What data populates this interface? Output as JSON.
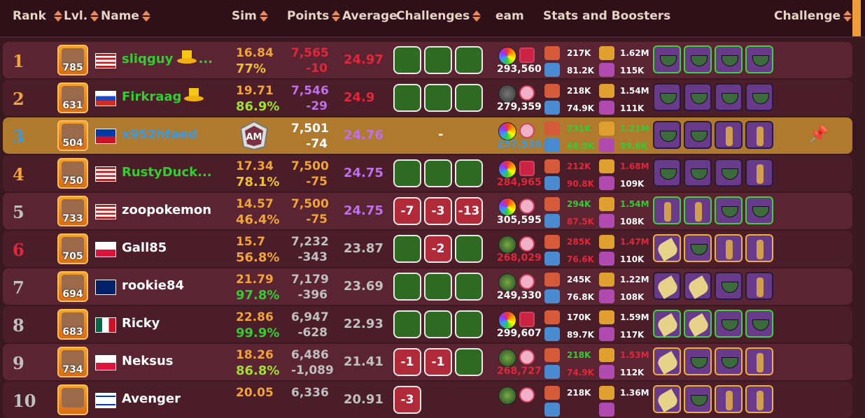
{
  "headers": {
    "rank": "Rank",
    "lvl": "Lvl.",
    "name": "Name",
    "sim": "Sim",
    "points": "Points",
    "average": "Average",
    "challenges": "Challenges",
    "team": "eam",
    "stats": "Stats and Boosters",
    "challenge": "Challenge"
  },
  "colors": {
    "row_dark": "#5a2433",
    "row_light": "#4a1d29",
    "row_me": "#b07a2e",
    "green_name": "#33cc33",
    "orange": "#f0a43a",
    "red_text": "#e0283a",
    "purple_text": "#c070e8"
  },
  "rows": [
    {
      "rank": "1",
      "rank_color": "#f0a43a",
      "level": "785",
      "flag": "us",
      "name": "sliqguy",
      "name_color": "#33cc33",
      "name_suffix": "...",
      "crown": "gold-top-hat",
      "sim_value": "16.84",
      "sim_pct": "77%",
      "sim_pct_color": "#f0c030",
      "points": "7,565",
      "points_color": "#e0283a",
      "diff": "-10",
      "diff_color": "#e0283a",
      "average": "24.97",
      "average_color": "#e0283a",
      "challenges": [
        {
          "type": "g",
          "text": ""
        },
        {
          "type": "g",
          "text": ""
        },
        {
          "type": "g",
          "text": ""
        }
      ],
      "team_orb": "rainbow",
      "team_badge": "kiss",
      "power": "293,560",
      "power_color": "#ffffff",
      "stats": {
        "atk": "217K",
        "hp": "81.2K",
        "ego": "1.62M",
        "harm": "115K"
      },
      "stats_colors": {
        "atk": "#ffffff",
        "hp": "#ffffff",
        "ego": "#ffffff",
        "harm": "#ffffff"
      },
      "boosters": [
        "bowl-g",
        "bowl-g",
        "bowl-g",
        "bowl-g"
      ]
    },
    {
      "rank": "2",
      "rank_color": "#f0a43a",
      "level": "631",
      "flag": "ru",
      "name": "Firkraag",
      "name_color": "#33cc33",
      "name_suffix": "",
      "crown": "gold-top-hat",
      "sim_value": "19.71",
      "sim_pct": "86.9%",
      "sim_pct_color": "#a0e030",
      "points": "7,546",
      "points_color": "#c070e8",
      "diff": "-29",
      "diff_color": "#c070e8",
      "average": "24.9",
      "average_color": "#e0283a",
      "challenges": [
        {
          "type": "g",
          "text": ""
        },
        {
          "type": "g",
          "text": ""
        },
        {
          "type": "g",
          "text": ""
        }
      ],
      "team_orb": "dark",
      "team_badge": "heart",
      "power": "279,359",
      "power_color": "#ffffff",
      "stats": {
        "atk": "218K",
        "hp": "74.9K",
        "ego": "1.54M",
        "harm": "111K"
      },
      "stats_colors": {
        "atk": "#ffffff",
        "hp": "#ffffff",
        "ego": "#ffffff",
        "harm": "#ffffff"
      },
      "boosters": [
        "bowl",
        "bowl",
        "bowl",
        "bowl"
      ]
    },
    {
      "rank": "3",
      "rank_color": "#3a9ae0",
      "level": "504",
      "flag": "ph",
      "name": "x952htaed",
      "name_color": "#3a9ae0",
      "name_suffix": "",
      "crown": "",
      "sim_value": "",
      "sim_pct": "",
      "sim_pct_color": "#ffffff",
      "points": "7,501",
      "points_color": "#ffffff",
      "diff": "-74",
      "diff_color": "#ffffff",
      "average": "24.76",
      "average_color": "#c070e8",
      "challenges": [],
      "dash": "-",
      "team_orb": "rainbow",
      "team_badge": "heart",
      "power": "257,536",
      "power_color": "#3a9ae0",
      "stats": {
        "atk": "231K",
        "hp": "68.5K",
        "ego": "1.21M",
        "harm": "99.6K"
      },
      "stats_colors": {
        "atk": "#33cc33",
        "hp": "#33cc33",
        "ego": "#33cc33",
        "harm": "#33cc33"
      },
      "boosters": [
        "bowl",
        "bowl",
        "gin",
        "gin"
      ]
    },
    {
      "rank": "4",
      "rank_color": "#f0a43a",
      "level": "750",
      "flag": "us",
      "name": "RustyDuck...",
      "name_color": "#33cc33",
      "name_suffix": "",
      "crown": "",
      "sim_value": "17.34",
      "sim_pct": "78.1%",
      "sim_pct_color": "#f0c030",
      "points": "7,500",
      "points_color": "#f0a43a",
      "diff": "-75",
      "diff_color": "#f0a43a",
      "average": "24.75",
      "average_color": "#c070e8",
      "challenges": [
        {
          "type": "g",
          "text": ""
        },
        {
          "type": "g",
          "text": ""
        },
        {
          "type": "g",
          "text": ""
        }
      ],
      "team_orb": "rainbow",
      "team_badge": "kiss",
      "power": "284,965",
      "power_color": "#e0283a",
      "stats": {
        "atk": "212K",
        "hp": "90.8K",
        "ego": "1.68M",
        "harm": "109K"
      },
      "stats_colors": {
        "atk": "#e0283a",
        "hp": "#e0283a",
        "ego": "#e0283a",
        "harm": "#ffffff"
      },
      "boosters": [
        "bowl",
        "bowl",
        "bowl",
        "gin"
      ]
    },
    {
      "rank": "5",
      "rank_color": "#c0c0c0",
      "level": "733",
      "flag": "us",
      "name": "zoopokemon",
      "name_color": "#ffffff",
      "name_suffix": "",
      "crown": "",
      "sim_value": "14.57",
      "sim_pct": "46.4%",
      "sim_pct_color": "#f0a43a",
      "points": "7,500",
      "points_color": "#f0a43a",
      "diff": "-75",
      "diff_color": "#f0a43a",
      "average": "24.75",
      "average_color": "#c070e8",
      "challenges": [
        {
          "type": "r",
          "text": "-7"
        },
        {
          "type": "r",
          "text": "-3"
        },
        {
          "type": "r",
          "text": "-13"
        }
      ],
      "team_orb": "rainbow",
      "team_badge": "heart",
      "power": "305,595",
      "power_color": "#ffffff",
      "stats": {
        "atk": "294K",
        "hp": "87.5K",
        "ego": "1.54M",
        "harm": "108K"
      },
      "stats_colors": {
        "atk": "#33cc33",
        "hp": "#e0283a",
        "ego": "#33cc33",
        "harm": "#ffffff"
      },
      "boosters": [
        "gin-g",
        "gin-g",
        "bowl-g",
        "bowl-g"
      ]
    },
    {
      "rank": "6",
      "rank_color": "#e0283a",
      "level": "705",
      "flag": "pl",
      "name": "Gall85",
      "name_color": "#ffffff",
      "name_suffix": "",
      "crown": "",
      "sim_value": "15.7",
      "sim_pct": "56.8%",
      "sim_pct_color": "#f0a43a",
      "points": "7,232",
      "points_color": "#c0c0c0",
      "diff": "-343",
      "diff_color": "#c0c0c0",
      "average": "23.87",
      "average_color": "#c0c0c0",
      "challenges": [
        {
          "type": "g",
          "text": ""
        },
        {
          "type": "r",
          "text": "-2"
        },
        {
          "type": "g",
          "text": ""
        }
      ],
      "team_orb": "green",
      "team_badge": "heart",
      "power": "268,029",
      "power_color": "#e0283a",
      "stats": {
        "atk": "285K",
        "hp": "76.6K",
        "ego": "1.47M",
        "harm": "110K"
      },
      "stats_colors": {
        "atk": "#e0283a",
        "hp": "#e0283a",
        "ego": "#e0283a",
        "harm": "#ffffff"
      },
      "boosters": [
        "leaf-o",
        "bowl-o",
        "gin-o",
        "gin-o"
      ]
    },
    {
      "rank": "7",
      "rank_color": "#c0c0c0",
      "level": "694",
      "flag": "gb",
      "name": "rookie84",
      "name_color": "#ffffff",
      "name_suffix": "",
      "crown": "",
      "sim_value": "21.79",
      "sim_pct": "97.8%",
      "sim_pct_color": "#33cc33",
      "points": "7,179",
      "points_color": "#c0c0c0",
      "diff": "-396",
      "diff_color": "#c0c0c0",
      "average": "23.69",
      "average_color": "#c0c0c0",
      "challenges": [
        {
          "type": "g",
          "text": ""
        },
        {
          "type": "g",
          "text": ""
        },
        {
          "type": "g",
          "text": ""
        }
      ],
      "team_orb": "green",
      "team_badge": "heart",
      "power": "249,330",
      "power_color": "#ffffff",
      "stats": {
        "atk": "245K",
        "hp": "76.8K",
        "ego": "1.22M",
        "harm": "108K"
      },
      "stats_colors": {
        "atk": "#ffffff",
        "hp": "#ffffff",
        "ego": "#ffffff",
        "harm": "#ffffff"
      },
      "boosters": [
        "leaf",
        "leaf",
        "bowl",
        "gin"
      ]
    },
    {
      "rank": "8",
      "rank_color": "#c0c0c0",
      "level": "683",
      "flag": "mx",
      "name": "Ricky",
      "name_color": "#ffffff",
      "name_suffix": "",
      "crown": "",
      "sim_value": "22.86",
      "sim_pct": "99.9%",
      "sim_pct_color": "#33cc33",
      "points": "6,947",
      "points_color": "#c0c0c0",
      "diff": "-628",
      "diff_color": "#c0c0c0",
      "average": "22.93",
      "average_color": "#c0c0c0",
      "challenges": [
        {
          "type": "g",
          "text": ""
        },
        {
          "type": "g",
          "text": ""
        },
        {
          "type": "g",
          "text": ""
        }
      ],
      "team_orb": "rainbow",
      "team_badge": "kiss",
      "power": "299,607",
      "power_color": "#ffffff",
      "stats": {
        "atk": "170K",
        "hp": "89.7K",
        "ego": "1.59M",
        "harm": "117K"
      },
      "stats_colors": {
        "atk": "#ffffff",
        "hp": "#ffffff",
        "ego": "#ffffff",
        "harm": "#ffffff"
      },
      "boosters": [
        "leaf-g",
        "leaf-g",
        "bowl-g",
        "bowl-g"
      ]
    },
    {
      "rank": "9",
      "rank_color": "#c0c0c0",
      "level": "734",
      "flag": "pl",
      "name": "Neksus",
      "name_color": "#ffffff",
      "name_suffix": "",
      "crown": "",
      "sim_value": "18.26",
      "sim_pct": "86.8%",
      "sim_pct_color": "#a0e030",
      "points": "6,486",
      "points_color": "#c0c0c0",
      "diff": "-1,089",
      "diff_color": "#c0c0c0",
      "average": "21.41",
      "average_color": "#c0c0c0",
      "challenges": [
        {
          "type": "r",
          "text": "-1"
        },
        {
          "type": "r",
          "text": "-1"
        },
        {
          "type": "g",
          "text": ""
        }
      ],
      "team_orb": "green",
      "team_badge": "heart",
      "power": "268,727",
      "power_color": "#e0283a",
      "stats": {
        "atk": "218K",
        "hp": "74.9K",
        "ego": "1.53M",
        "harm": "112K"
      },
      "stats_colors": {
        "atk": "#33cc33",
        "hp": "#e0283a",
        "ego": "#e0283a",
        "harm": "#ffffff"
      },
      "boosters": [
        "leaf-o",
        "bowl-o",
        "bowl-o",
        "gin-o"
      ]
    },
    {
      "rank": "10",
      "rank_color": "#c0c0c0",
      "level": "",
      "flag": "il",
      "name": "Avenger",
      "name_color": "#ffffff",
      "name_suffix": "",
      "crown": "",
      "sim_value": "20.05",
      "sim_pct": "",
      "sim_pct_color": "#ffffff",
      "points": "6,336",
      "points_color": "#c0c0c0",
      "diff": "",
      "diff_color": "#c0c0c0",
      "average": "20.91",
      "average_color": "#c0c0c0",
      "challenges": [
        {
          "type": "r",
          "text": "-3"
        }
      ],
      "team_orb": "green",
      "team_badge": "heart",
      "power": "",
      "power_color": "#ffffff",
      "stats": {
        "atk": "218K",
        "hp": "",
        "ego": "1.36M",
        "harm": ""
      },
      "stats_colors": {
        "atk": "#ffffff",
        "hp": "#ffffff",
        "ego": "#ffffff",
        "harm": "#ffffff"
      },
      "boosters": [
        "leaf-o",
        "bowl-o",
        "gin-o",
        "gin-o"
      ]
    }
  ]
}
